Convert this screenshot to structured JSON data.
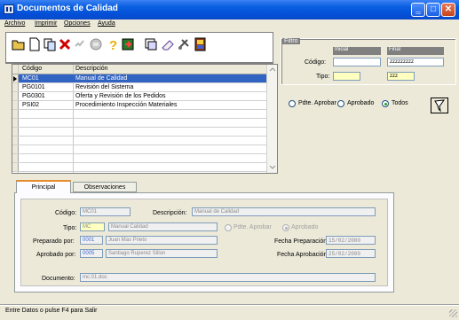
{
  "window": {
    "title": "Documentos de Calidad",
    "minimize": "‗",
    "maximize": "□",
    "close": "✕"
  },
  "menu": [
    "Archivo",
    "Imprimir",
    "Opciones",
    "Ayuda"
  ],
  "toolbar": [
    "open-folder-icon",
    "new-document-icon",
    "copy-icon",
    "delete-icon",
    "edit-icon",
    "print-icon",
    "help-icon",
    "refresh-icon",
    "stack-icon",
    "clear-icon",
    "settings-icon",
    "exit-icon"
  ],
  "grid": {
    "headers": [
      "Código",
      "Descripción"
    ],
    "rows": [
      [
        "MC01",
        "Manual de Calidad"
      ],
      [
        "PG0101",
        "Revisión del Sistema"
      ],
      [
        "PG0301",
        "Oferta y Revisión de los Pedidos"
      ],
      [
        "PSI02",
        "Procedimiento Inspección Materiales"
      ]
    ]
  },
  "filter": {
    "title": "Filtro",
    "inicial_label": "Inicial",
    "final_label": "Final",
    "codigo_label": "Código:",
    "tipo_label": "Tipo:",
    "codigo_inicial": "",
    "codigo_final": "zzzzzzzzz",
    "tipo_inicial": "",
    "tipo_final": "zzz",
    "radio_pdte": "Pdte. Aprobar",
    "radio_aprobado": "Aprobado",
    "radio_todos": "Todos"
  },
  "tabs": [
    "Principal",
    "Observaciones"
  ],
  "detail": {
    "codigo_label": "Código:",
    "codigo": "MC01",
    "descripcion_label": "Descripción:",
    "descripcion": "Manual de Calidad",
    "tipo_label": "Tipo:",
    "tipo": "MC",
    "tipo_desc": "Manual Calidad",
    "radio_pdte": "Pdte. Aprobar",
    "radio_aprobado": "Aprobado",
    "preparado_label": "Preparado por:",
    "preparado_code": "0001",
    "preparado_name": "Juan Mas Prieto",
    "fecha_prep_label": "Fecha Preparación:",
    "fecha_prep": "15/02/2000",
    "aprobado_label": "Aprobado por:",
    "aprobado_code": "0005",
    "aprobado_name": "Santiago Ruperez Sillon",
    "fecha_aprob_label": "Fecha Aprobación:",
    "fecha_aprob": "25/02/2000",
    "documento_label": "Documento:",
    "documento": "mc.01.doc"
  },
  "status": "Entre Datos o pulse F4 para Salir",
  "colors": {
    "title": "#0350d8",
    "selection": "#3163c2",
    "panel": "#ece9d8",
    "yellow_field": "#ffffc0"
  }
}
